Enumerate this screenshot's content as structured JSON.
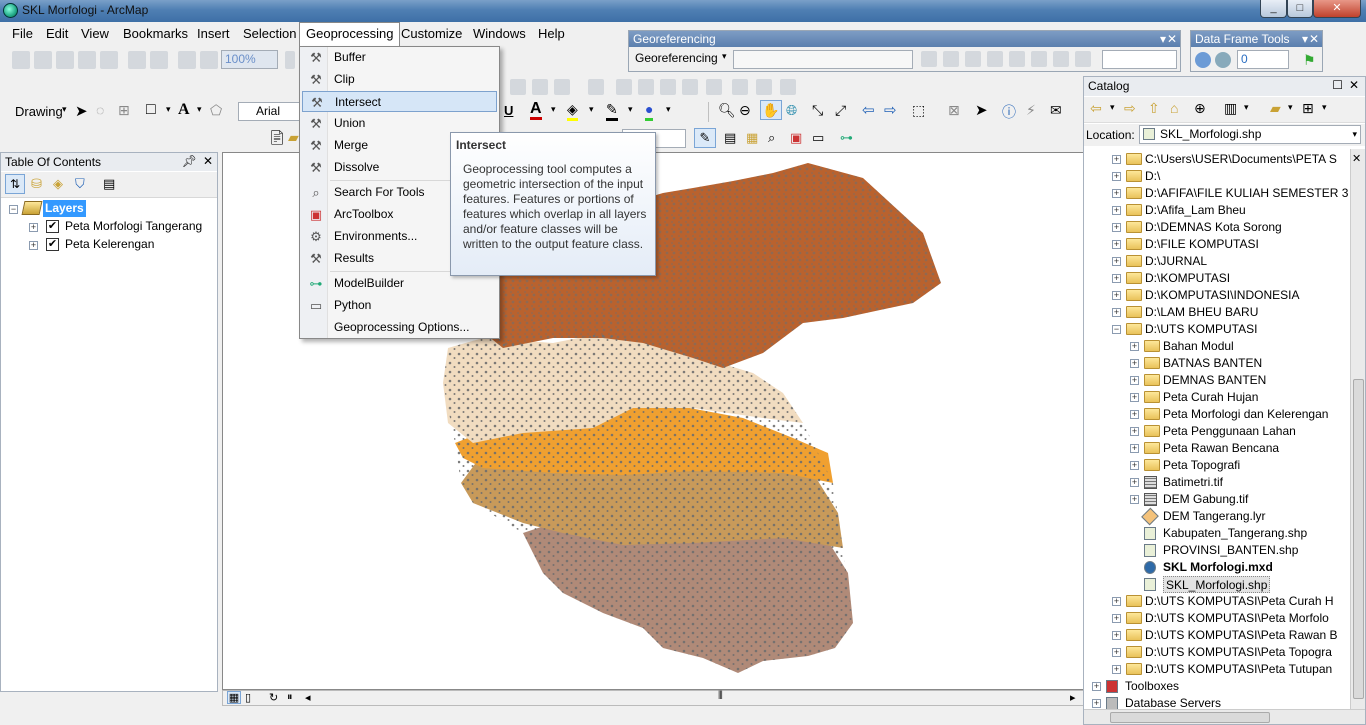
{
  "window": {
    "title": "SKL Morfologi - ArcMap"
  },
  "menubar": {
    "items": [
      "File",
      "Edit",
      "View",
      "Bookmarks",
      "Insert",
      "Selection",
      "Geoprocessing",
      "Customize",
      "Windows",
      "Help"
    ]
  },
  "toolbar": {
    "zoom_value": "100%",
    "drawing_label": "Drawing",
    "font_name": "Arial"
  },
  "georeferencing": {
    "title": "Georeferencing",
    "menu_label": "Georeferencing"
  },
  "data_frame_tools": {
    "title": "Data Frame Tools",
    "value": "0"
  },
  "toc": {
    "title": "Table Of Contents",
    "root": "Layers",
    "layers": [
      "Peta Morfologi Tangerang",
      "Peta Kelerengan"
    ]
  },
  "geoprocessing_menu": {
    "items": [
      "Buffer",
      "Clip",
      "Intersect",
      "Union",
      "Merge",
      "Dissolve",
      "Search For Tools",
      "ArcToolbox",
      "Environments...",
      "Results",
      "ModelBuilder",
      "Python",
      "Geoprocessing Options..."
    ],
    "highlighted": "Intersect"
  },
  "tooltip": {
    "title": "Intersect",
    "body": "Geoprocessing tool computes a geometric intersection of the input features. Features or portions of features which overlap in all layers and/or feature classes will be written to the output feature class."
  },
  "catalog": {
    "title": "Catalog",
    "location_label": "Location:",
    "location_value": "SKL_Morfologi.shp",
    "items": [
      {
        "label": "C:\\Users\\USER\\Documents\\PETA S",
        "type": "folder",
        "level": 0
      },
      {
        "label": "D:\\",
        "type": "folder",
        "level": 0
      },
      {
        "label": "D:\\AFIFA\\FILE KULIAH SEMESTER 3",
        "type": "folder",
        "level": 0
      },
      {
        "label": "D:\\Afifa_Lam Bheu",
        "type": "folder",
        "level": 0
      },
      {
        "label": "D:\\DEMNAS Kota Sorong",
        "type": "folder",
        "level": 0
      },
      {
        "label": "D:\\FILE KOMPUTASI",
        "type": "folder",
        "level": 0
      },
      {
        "label": "D:\\JURNAL",
        "type": "folder",
        "level": 0
      },
      {
        "label": "D:\\KOMPUTASI",
        "type": "folder",
        "level": 0
      },
      {
        "label": "D:\\KOMPUTASI\\INDONESIA",
        "type": "folder",
        "level": 0
      },
      {
        "label": "D:\\LAM BHEU BARU",
        "type": "folder",
        "level": 0
      },
      {
        "label": "D:\\UTS KOMPUTASI",
        "type": "folder",
        "level": 0,
        "expanded": true
      },
      {
        "label": "Bahan Modul",
        "type": "folder",
        "level": 1
      },
      {
        "label": "BATNAS BANTEN",
        "type": "folder",
        "level": 1
      },
      {
        "label": "DEMNAS BANTEN",
        "type": "folder",
        "level": 1
      },
      {
        "label": "Peta Curah Hujan",
        "type": "folder",
        "level": 1
      },
      {
        "label": "Peta Morfologi dan Kelerengan",
        "type": "folder",
        "level": 1
      },
      {
        "label": "Peta Penggunaan Lahan",
        "type": "folder",
        "level": 1
      },
      {
        "label": "Peta Rawan Bencana",
        "type": "folder",
        "level": 1
      },
      {
        "label": "Peta Topografi",
        "type": "folder",
        "level": 1
      },
      {
        "label": "Batimetri.tif",
        "type": "raster",
        "level": 1
      },
      {
        "label": "DEM Gabung.tif",
        "type": "raster",
        "level": 1
      },
      {
        "label": "DEM Tangerang.lyr",
        "type": "layer",
        "level": 1
      },
      {
        "label": "Kabupaten_Tangerang.shp",
        "type": "shp",
        "level": 1
      },
      {
        "label": "PROVINSI_BANTEN.shp",
        "type": "shp",
        "level": 1
      },
      {
        "label": "SKL Morfologi.mxd",
        "type": "mxd",
        "level": 1,
        "bold": true
      },
      {
        "label": "SKL_Morfologi.shp",
        "type": "shp",
        "level": 1,
        "selected": true
      },
      {
        "label": "D:\\UTS KOMPUTASI\\Peta Curah H",
        "type": "folder",
        "level": 0
      },
      {
        "label": "D:\\UTS KOMPUTASI\\Peta Morfolo",
        "type": "folder",
        "level": 0
      },
      {
        "label": "D:\\UTS KOMPUTASI\\Peta Rawan B",
        "type": "folder",
        "level": 0
      },
      {
        "label": "D:\\UTS KOMPUTASI\\Peta Topogra",
        "type": "folder",
        "level": 0
      },
      {
        "label": "D:\\UTS KOMPUTASI\\Peta Tutupan",
        "type": "folder",
        "level": 0
      },
      {
        "label": "Toolboxes",
        "type": "toolbox",
        "level": -1
      },
      {
        "label": "Database Servers",
        "type": "server",
        "level": -1
      }
    ]
  },
  "colors": {
    "map_brown": "#b9622e",
    "map_cream": "#f1dcc0",
    "map_orange": "#f0a030",
    "map_tan": "#c89a5a",
    "map_mauve": "#b08a78",
    "map_grey": "#6e6e6e",
    "accent_blue": "#3399ff"
  }
}
